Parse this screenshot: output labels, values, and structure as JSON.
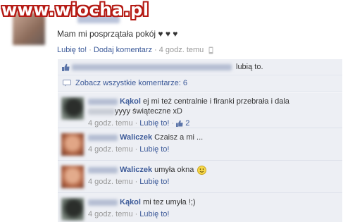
{
  "watermark": "www.wiocha.pl",
  "status": {
    "text": "Mam mi posprzątała pokój ♥ ♥ ♥",
    "actions": {
      "like": "Lubię to!",
      "comment": "Dodaj komentarz",
      "time": "4 godz. temu"
    }
  },
  "likes": {
    "text": "lubią to."
  },
  "view_all": {
    "label": "Zobacz wszystkie komentarze: 6"
  },
  "comments": [
    {
      "author": "Kąkol",
      "text_line1": "ej mi też centralnie i firanki przebrała i dala",
      "text_line2": "yyyy świąteczne xD",
      "time": "4 godz. temu",
      "like": "Lubię to!",
      "like_count": "2"
    },
    {
      "author": "Waliczek",
      "text": "Czaisz a mi ...",
      "time": "4 godz. temu",
      "like": "Lubię to!"
    },
    {
      "author": "Waliczek",
      "text": "umyła okna",
      "time": "4 godz. temu",
      "like": "Lubię to!"
    },
    {
      "author": "Kąkol",
      "text": "mi tez umyła !;)",
      "time": "4 godz. temu",
      "like": "Lubię to!"
    }
  ],
  "colors": {
    "link": "#3b5998",
    "panel": "#edeff4",
    "meta": "#999999",
    "watermark": "#b51a14"
  }
}
